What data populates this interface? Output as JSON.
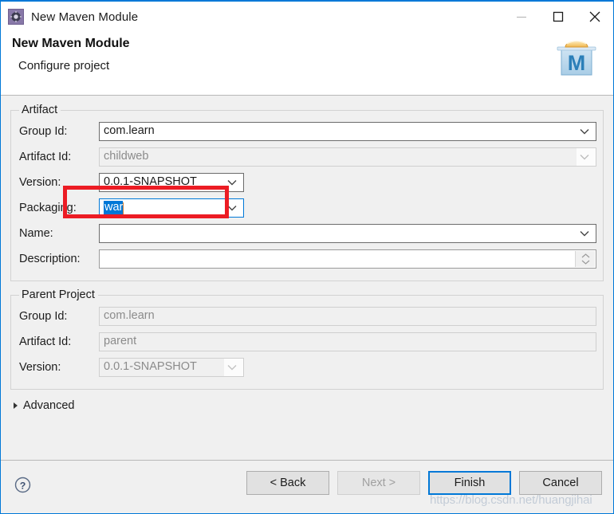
{
  "window": {
    "title": "New Maven Module",
    "title_icon": "maven-module-gear-icon",
    "minimize_label": "minimize-icon",
    "maximize_label": "maximize-icon",
    "close_label": "close-icon"
  },
  "header": {
    "title": "New Maven Module",
    "subtitle": "Configure project",
    "logo": "maven-logo-icon"
  },
  "artifact": {
    "legend": "Artifact",
    "fields": [
      {
        "label": "Group Id:",
        "value": "com.learn",
        "placeholder": "",
        "type": "combo",
        "enabled": true
      },
      {
        "label": "Artifact Id:",
        "value": "childweb",
        "placeholder": "",
        "type": "combo",
        "enabled": false
      },
      {
        "label": "Version:",
        "value": "0.0.1-SNAPSHOT",
        "placeholder": "",
        "type": "combo-narrow",
        "enabled": true
      },
      {
        "label": "Packaging:",
        "value": "war",
        "placeholder": "",
        "type": "combo-narrow-focused",
        "enabled": true
      },
      {
        "label": "Name:",
        "value": "",
        "placeholder": "",
        "type": "combo",
        "enabled": true
      },
      {
        "label": "Description:",
        "value": "",
        "placeholder": "",
        "type": "text-spinner",
        "enabled": true
      }
    ]
  },
  "parent_project": {
    "legend": "Parent Project",
    "fields": [
      {
        "label": "Group Id:",
        "value": "com.learn",
        "placeholder": "",
        "type": "text",
        "enabled": false
      },
      {
        "label": "Artifact Id:",
        "value": "parent",
        "placeholder": "",
        "type": "text",
        "enabled": false
      },
      {
        "label": "Version:",
        "value": "0.0.1-SNAPSHOT",
        "placeholder": "",
        "type": "combo-narrow",
        "enabled": false
      }
    ]
  },
  "advanced": {
    "label": "Advanced",
    "expanded": false,
    "icon": "chevron-right-icon"
  },
  "footer": {
    "help_icon": "help-question-icon",
    "buttons": [
      {
        "label": "< Back",
        "enabled": true,
        "default": false
      },
      {
        "label": "Next >",
        "enabled": false,
        "default": false
      },
      {
        "label": "Finish",
        "enabled": true,
        "default": true
      },
      {
        "label": "Cancel",
        "enabled": true,
        "default": false
      }
    ]
  },
  "annotation": {
    "color": "#ec1c24",
    "target": "packaging-combo"
  },
  "watermark": {
    "text": "https://blog.csdn.net/huangjihai"
  },
  "colors": {
    "window_border": "#0078d7",
    "body_background": "#f0f0f0",
    "selection": "#0078d7",
    "annotation_red": "#ec1c24",
    "disabled_text": "#8b8b8b"
  }
}
